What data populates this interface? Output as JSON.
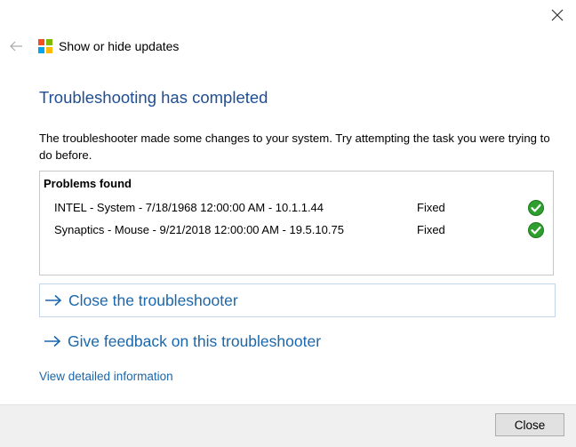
{
  "window": {
    "title": "Show or hide updates"
  },
  "icons": {
    "back": "arrow-left-icon",
    "close": "close-icon",
    "logo": "microsoft-windows-logo",
    "link_arrow": "arrow-right-icon",
    "status_check": "green-checkmark-icon"
  },
  "colors": {
    "heading": "#1e4e94",
    "link": "#1a67ad",
    "logo_red": "#f25022",
    "logo_green": "#7fba00",
    "logo_blue": "#00a4ef",
    "logo_yellow": "#ffb900",
    "check_green": "#2e9e2e"
  },
  "main": {
    "heading": "Troubleshooting has completed",
    "description": "The troubleshooter made some changes to your system. Try attempting the task you were trying to do before.",
    "problems": {
      "title": "Problems found",
      "items": [
        {
          "name": "INTEL - System - 7/18/1968 12:00:00 AM - 10.1.1.44",
          "status": "Fixed"
        },
        {
          "name": "Synaptics - Mouse - 9/21/2018 12:00:00 AM - 19.5.10.75",
          "status": "Fixed"
        }
      ]
    },
    "actions": [
      {
        "label": "Close the troubleshooter"
      },
      {
        "label": "Give feedback on this troubleshooter"
      }
    ],
    "detail_link": "View detailed information"
  },
  "footer": {
    "close_label": "Close"
  }
}
